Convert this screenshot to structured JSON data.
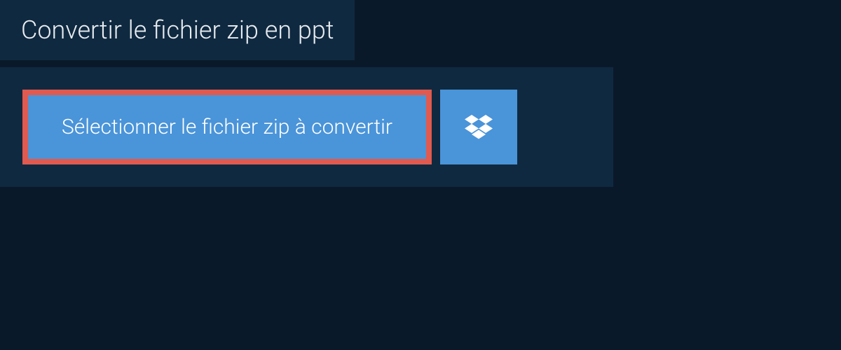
{
  "title": "Convertir le fichier zip en ppt",
  "buttons": {
    "select_label": "Sélectionner le fichier zip à convertir"
  }
}
